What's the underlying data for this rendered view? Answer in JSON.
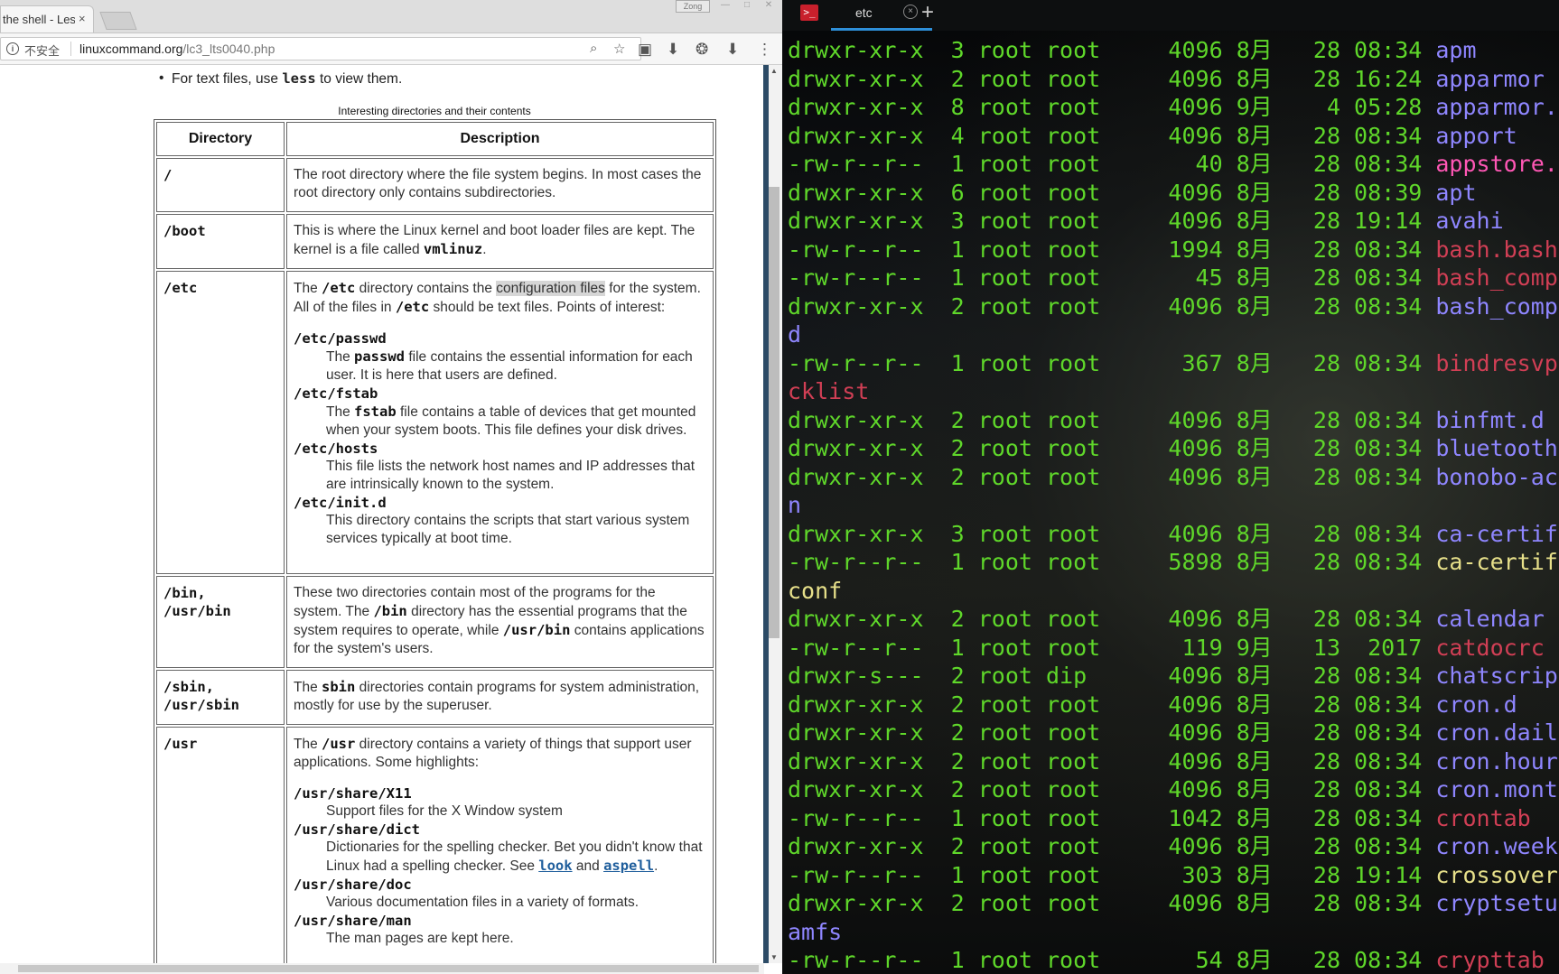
{
  "browser": {
    "tab_title": "the shell - Les",
    "tab_close": "×",
    "window_user": "Zong",
    "window_buttons": [
      "—",
      "□",
      "✕"
    ],
    "address": {
      "security_label": "不安全",
      "url_domain": "linuxcommand.org",
      "url_path": "/lc3_lts0040.php"
    },
    "icons": [
      "zoom-icon",
      "star-icon",
      "extension-icon",
      "download-icon",
      "puzzle-icon",
      "download-icon",
      "menu-icon"
    ]
  },
  "page": {
    "bullet_prefix": "For text files, use ",
    "bullet_cmd": "less",
    "bullet_suffix": " to view them.",
    "table_caption": "Interesting directories and their contents",
    "col_directory": "Directory",
    "col_description": "Description",
    "rows": [
      {
        "dir": "/",
        "desc": "The root directory where the file system begins. In most cases the root directory only contains subdirectories."
      },
      {
        "dir": "/boot",
        "desc_a": "This is where the Linux kernel and boot loader files are kept. The kernel is a file called ",
        "desc_cmd": "vmlinuz",
        "desc_b": "."
      },
      {
        "dir": "/etc",
        "p1": "The ",
        "p2": "/etc",
        "p3": " directory contains the ",
        "p4": "configuration files",
        "p5": " for the system. All of the files in ",
        "p6": "/etc",
        "p7": " should be text files. Points of interest:",
        "items": [
          {
            "term": "/etc/passwd",
            "d1": "The ",
            "d2": "passwd",
            "d3": " file contains the essential information for each user. It is here that users are defined."
          },
          {
            "term": "/etc/fstab",
            "d1": "The ",
            "d2": "fstab",
            "d3": " file contains a table of devices that get mounted when your system boots. This file defines your disk drives."
          },
          {
            "term": "/etc/hosts",
            "d1": "This file lists the network host names and IP addresses that are intrinsically known to the system.",
            "d2": "",
            "d3": ""
          },
          {
            "term": "/etc/init.d",
            "d1": "This directory contains the scripts that start various system services typically at boot time.",
            "d2": "",
            "d3": ""
          }
        ]
      },
      {
        "dir": "/bin,\n/usr/bin",
        "p1": "These two directories contain most of the programs for the system. The ",
        "p2": "/bin",
        "p3": " directory has the essential programs that the system requires to operate, while ",
        "p4": "/usr/bin",
        "p5": " contains applications for the system's users."
      },
      {
        "dir": "/sbin,\n/usr/sbin",
        "p1": "The ",
        "p2": "sbin",
        "p3": " directories contain programs for system administration, mostly for use by the superuser."
      },
      {
        "dir": "/usr",
        "p1": "The ",
        "p2": "/usr",
        "p3": " directory contains a variety of things that support user applications. Some highlights:",
        "items": [
          {
            "term": "/usr/share/X11",
            "d1": "Support files for the X Window system"
          },
          {
            "term": "/usr/share/dict",
            "d1": "Dictionaries for the spelling checker. Bet you didn't know that Linux had a spelling checker. See ",
            "link1": "look",
            "d2": " and ",
            "link2": "aspell",
            "d3": "."
          },
          {
            "term": "/usr/share/doc",
            "d1": "Various documentation files in a variety of formats."
          },
          {
            "term": "/usr/share/man",
            "d1": "The man pages are kept here."
          }
        ]
      }
    ]
  },
  "terminal": {
    "tab_title": "etc",
    "tab_close": "×",
    "new_tab": "+",
    "top_partial": "                 ,                                    ,",
    "lines": [
      {
        "prefix": "drwxr-xr-x  3 root root     4096 8月   28 08:34 ",
        "name": "apm",
        "color": "blue"
      },
      {
        "prefix": "drwxr-xr-x  2 root root     4096 8月   28 16:24 ",
        "name": "apparmor",
        "color": "blue"
      },
      {
        "prefix": "drwxr-xr-x  8 root root     4096 9月    4 05:28 ",
        "name": "apparmor.",
        "color": "blue"
      },
      {
        "prefix": "drwxr-xr-x  4 root root     4096 8月   28 08:34 ",
        "name": "apport",
        "color": "blue"
      },
      {
        "prefix": "-rw-r--r--  1 root root       40 8月   28 08:34 ",
        "name": "appstore.",
        "color": "pink"
      },
      {
        "prefix": "drwxr-xr-x  6 root root     4096 8月   28 08:39 ",
        "name": "apt",
        "color": "blue"
      },
      {
        "prefix": "drwxr-xr-x  3 root root     4096 8月   28 19:14 ",
        "name": "avahi",
        "color": "blue"
      },
      {
        "prefix": "-rw-r--r--  1 root root     1994 8月   28 08:34 ",
        "name": "bash.bash",
        "color": "red"
      },
      {
        "prefix": "-rw-r--r--  1 root root       45 8月   28 08:34 ",
        "name": "bash_comp",
        "color": "red"
      },
      {
        "prefix": "drwxr-xr-x  2 root root     4096 8月   28 08:34 ",
        "name": "bash_comp",
        "color": "blue"
      },
      {
        "prefix": "",
        "name": "d",
        "color": "blue"
      },
      {
        "prefix": "-rw-r--r--  1 root root      367 8月   28 08:34 ",
        "name": "bindresvp",
        "color": "red"
      },
      {
        "prefix": "",
        "name": "cklist",
        "color": "red"
      },
      {
        "prefix": "drwxr-xr-x  2 root root     4096 8月   28 08:34 ",
        "name": "binfmt.d",
        "color": "blue"
      },
      {
        "prefix": "drwxr-xr-x  2 root root     4096 8月   28 08:34 ",
        "name": "bluetooth",
        "color": "blue"
      },
      {
        "prefix": "drwxr-xr-x  2 root root     4096 8月   28 08:34 ",
        "name": "bonobo-ac",
        "color": "blue"
      },
      {
        "prefix": "",
        "name": "n",
        "color": "blue"
      },
      {
        "prefix": "drwxr-xr-x  3 root root     4096 8月   28 08:34 ",
        "name": "ca-certif",
        "color": "blue"
      },
      {
        "prefix": "-rw-r--r--  1 root root     5898 8月   28 08:34 ",
        "name": "ca-certif",
        "color": "yellow"
      },
      {
        "prefix": "",
        "name": "conf",
        "color": "yellow"
      },
      {
        "prefix": "drwxr-xr-x  2 root root     4096 8月   28 08:34 ",
        "name": "calendar",
        "color": "blue"
      },
      {
        "prefix": "-rw-r--r--  1 root root      119 9月   13  2017 ",
        "name": "catdocrc",
        "color": "red"
      },
      {
        "prefix": "drwxr-s---  2 root dip      4096 8月   28 08:34 ",
        "name": "chatscrip",
        "color": "blue"
      },
      {
        "prefix": "drwxr-xr-x  2 root root     4096 8月   28 08:34 ",
        "name": "cron.d",
        "color": "blue"
      },
      {
        "prefix": "drwxr-xr-x  2 root root     4096 8月   28 08:34 ",
        "name": "cron.dail",
        "color": "blue"
      },
      {
        "prefix": "drwxr-xr-x  2 root root     4096 8月   28 08:34 ",
        "name": "cron.hour",
        "color": "blue"
      },
      {
        "prefix": "drwxr-xr-x  2 root root     4096 8月   28 08:34 ",
        "name": "cron.mont",
        "color": "blue"
      },
      {
        "prefix": "-rw-r--r--  1 root root     1042 8月   28 08:34 ",
        "name": "crontab",
        "color": "red"
      },
      {
        "prefix": "drwxr-xr-x  2 root root     4096 8月   28 08:34 ",
        "name": "cron.week",
        "color": "blue"
      },
      {
        "prefix": "-rw-r--r--  1 root root      303 8月   28 19:14 ",
        "name": "crossover",
        "color": "yellow"
      },
      {
        "prefix": "drwxr-xr-x  2 root root     4096 8月   28 08:34 ",
        "name": "cryptsetu",
        "color": "blue"
      },
      {
        "prefix": "",
        "name": "amfs",
        "color": "blue"
      },
      {
        "prefix": "-rw-r--r--  1 root root       54 8月   28 08:34 ",
        "name": "crypttab",
        "color": "red"
      }
    ]
  },
  "colors": {
    "terminal_green": "#5fd72a",
    "dir_blue": "#8f86ff",
    "pink": "#ff57b5",
    "red": "#d13f55",
    "yellow": "#e7e08a",
    "link_blue": "#1f5e9c",
    "tab_accent": "#2e8fd8"
  }
}
